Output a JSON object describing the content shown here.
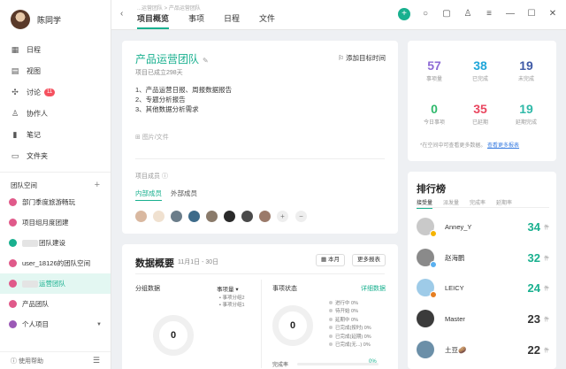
{
  "user": {
    "name": "陈同学"
  },
  "nav": [
    {
      "label": "日程",
      "icon": "calendar-icon"
    },
    {
      "label": "视图",
      "icon": "view-icon"
    },
    {
      "label": "讨论",
      "icon": "discussion-icon",
      "badge": "11"
    },
    {
      "label": "协作人",
      "icon": "person-icon"
    },
    {
      "label": "笔记",
      "icon": "note-icon"
    },
    {
      "label": "文件夹",
      "icon": "folder-icon"
    }
  ],
  "team": {
    "header": "团队空间",
    "items": [
      {
        "label": "部门季度旅游畅玩",
        "color": "#e05a8a"
      },
      {
        "label": "项目组月度团建",
        "color": "#e05a8a"
      },
      {
        "label": "团队建设",
        "color": "#19b08f",
        "blurred": true
      },
      {
        "label": "user_18126的团队空间",
        "color": "#e05a8a"
      },
      {
        "label": "运营团队",
        "color": "#e05a8a",
        "blurred": true,
        "active": true
      },
      {
        "label": "产品团队",
        "color": "#e05a8a"
      },
      {
        "label": "个人项目",
        "color": "#9b59b6",
        "caret": true
      }
    ]
  },
  "footer": {
    "help": "使用帮助"
  },
  "topbar": {
    "breadcrumb": "...运营团队 > 产品运营团队",
    "tabs": [
      "项目概览",
      "事项",
      "日程",
      "文件"
    ]
  },
  "project": {
    "title": "产品运营团队",
    "subtitle": "项目已成立298天",
    "add_goal": "添加目标时间",
    "desc": [
      "1、产品运营日报、周报数据报告",
      "2、专题分析报告",
      "3、其他数据分析需求"
    ],
    "attach": "图片/文件",
    "members_label": "项目成员",
    "member_tabs": [
      "内部成员",
      "外部成员"
    ]
  },
  "overview": {
    "title": "数据概要",
    "range": "11月1日 - 30日",
    "month_btn": "本月",
    "more_btn": "更多报表",
    "group_label": "分组数据",
    "group_select": "事项量",
    "group_legend": [
      "事项分组2",
      "事项分组1"
    ],
    "group_value": "0",
    "status_label": "事项状态",
    "detail_link": "详细数据",
    "status_value": "0",
    "status_items": [
      "进行中 0%",
      "待开始 0%",
      "延期中 0%",
      "已完成(按时) 0%",
      "已完成(延期) 0%",
      "已完成(无...) 0%"
    ],
    "done_label": "完成率",
    "done_pct": "0%"
  },
  "stats": {
    "row1": [
      {
        "num": "57",
        "label": "事项量",
        "color": "#8e6bd6"
      },
      {
        "num": "38",
        "label": "已完成",
        "color": "#1fa6d9"
      },
      {
        "num": "19",
        "label": "未完成",
        "color": "#3f5aa6"
      }
    ],
    "row2": [
      {
        "num": "0",
        "label": "今日事项",
        "color": "#2fb96c"
      },
      {
        "num": "35",
        "label": "已延期",
        "color": "#e9465f"
      },
      {
        "num": "19",
        "label": "延期完成",
        "color": "#2fb9a8"
      }
    ],
    "note": "*在空间中可查看更多数据。",
    "note_link": "查看更多报表"
  },
  "rank": {
    "title": "排行榜",
    "tabs": [
      "接受量",
      "派发量",
      "完成率",
      "延期率"
    ],
    "unit": "件",
    "rows": [
      {
        "name": "Anney_Y",
        "num": "34",
        "color": "#19b08f",
        "av": "#c9c9c9",
        "crown": "#f5b400"
      },
      {
        "name": "赵海鹏",
        "num": "32",
        "color": "#19b08f",
        "av": "#8a8a8a",
        "crown": "#5ab0f0"
      },
      {
        "name": "LEICY",
        "num": "24",
        "color": "#19b08f",
        "av": "#9ecbe8",
        "crown": "#e67e22"
      },
      {
        "name": "Master",
        "num": "23",
        "color": "#333333",
        "av": "#3b3b3b"
      },
      {
        "name": "土豆🥔",
        "num": "22",
        "color": "#333333",
        "av": "#6b8fa8"
      }
    ]
  }
}
